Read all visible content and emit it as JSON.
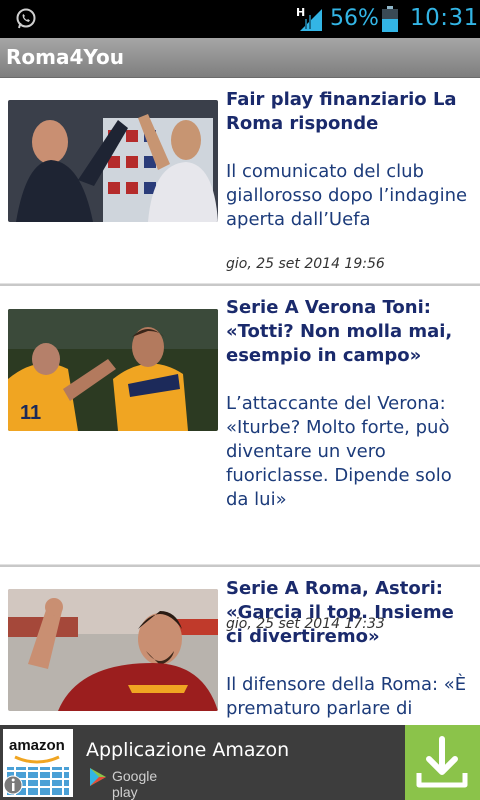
{
  "status_bar": {
    "battery_percent": "56%",
    "time": "10:31",
    "network_type": "H",
    "icons": [
      "whatsapp-icon",
      "signal-icon",
      "battery-icon"
    ]
  },
  "action_bar": {
    "title": "Roma4You"
  },
  "articles": [
    {
      "title": "Fair play finanziario La Roma risponde",
      "summary": "Il comunicato del club giallorosso dopo l’indagine aperta dall’Uefa",
      "date": "gio, 25 set 2014 19:56"
    },
    {
      "title": "Serie A Verona Toni: «Totti? Non molla mai, esempio in campo»",
      "summary": "L’attaccante del Verona: «Iturbe? Molto forte, può diventare un vero fuoriclasse. Dipende solo da lui»",
      "date": "gio, 25 set 2014 17:33"
    },
    {
      "title": "Serie A Roma, Astori: «Garcia il top. Insieme ci divertiremo»",
      "summary": "Il difensore della Roma: «È prematuro parlare di",
      "date": ""
    }
  ],
  "ad": {
    "brand": "amazon",
    "title": "Applicazione Amazon",
    "store": "Google play",
    "accent": "#8bc34a"
  }
}
